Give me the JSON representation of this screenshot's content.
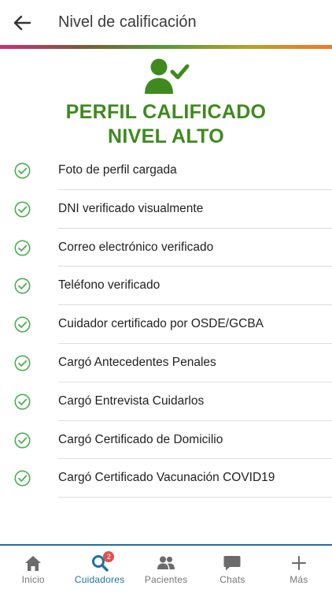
{
  "header": {
    "title": "Nivel de calificación"
  },
  "hero": {
    "title_line1": "PERFIL CALIFICADO",
    "title_line2": "NIVEL ALTO",
    "accent_color": "#3e8a1e"
  },
  "checklist": [
    {
      "label": "Foto de perfil cargada",
      "checked": true
    },
    {
      "label": "DNI verificado visualmente",
      "checked": true
    },
    {
      "label": "Correo electrónico verificado",
      "checked": true
    },
    {
      "label": "Teléfono verificado",
      "checked": true
    },
    {
      "label": "Cuidador certificado por OSDE/GCBA",
      "checked": true
    },
    {
      "label": "Cargó Antecedentes Penales",
      "checked": true
    },
    {
      "label": "Cargó Entrevista Cuidarlos",
      "checked": true
    },
    {
      "label": "Cargó Certificado de Domicilio",
      "checked": true
    },
    {
      "label": "Cargó Certificado Vacunación COVID19",
      "checked": true
    }
  ],
  "bottom_nav": {
    "items": [
      {
        "label": "Inicio",
        "icon": "home-icon",
        "active": false
      },
      {
        "label": "Cuidadores",
        "icon": "search-icon",
        "active": true,
        "badge": "2"
      },
      {
        "label": "Pacientes",
        "icon": "people-icon",
        "active": false
      },
      {
        "label": "Chats",
        "icon": "chat-icon",
        "active": false
      },
      {
        "label": "Más",
        "icon": "plus-icon",
        "active": false
      }
    ],
    "active_color": "#1e71a6"
  }
}
